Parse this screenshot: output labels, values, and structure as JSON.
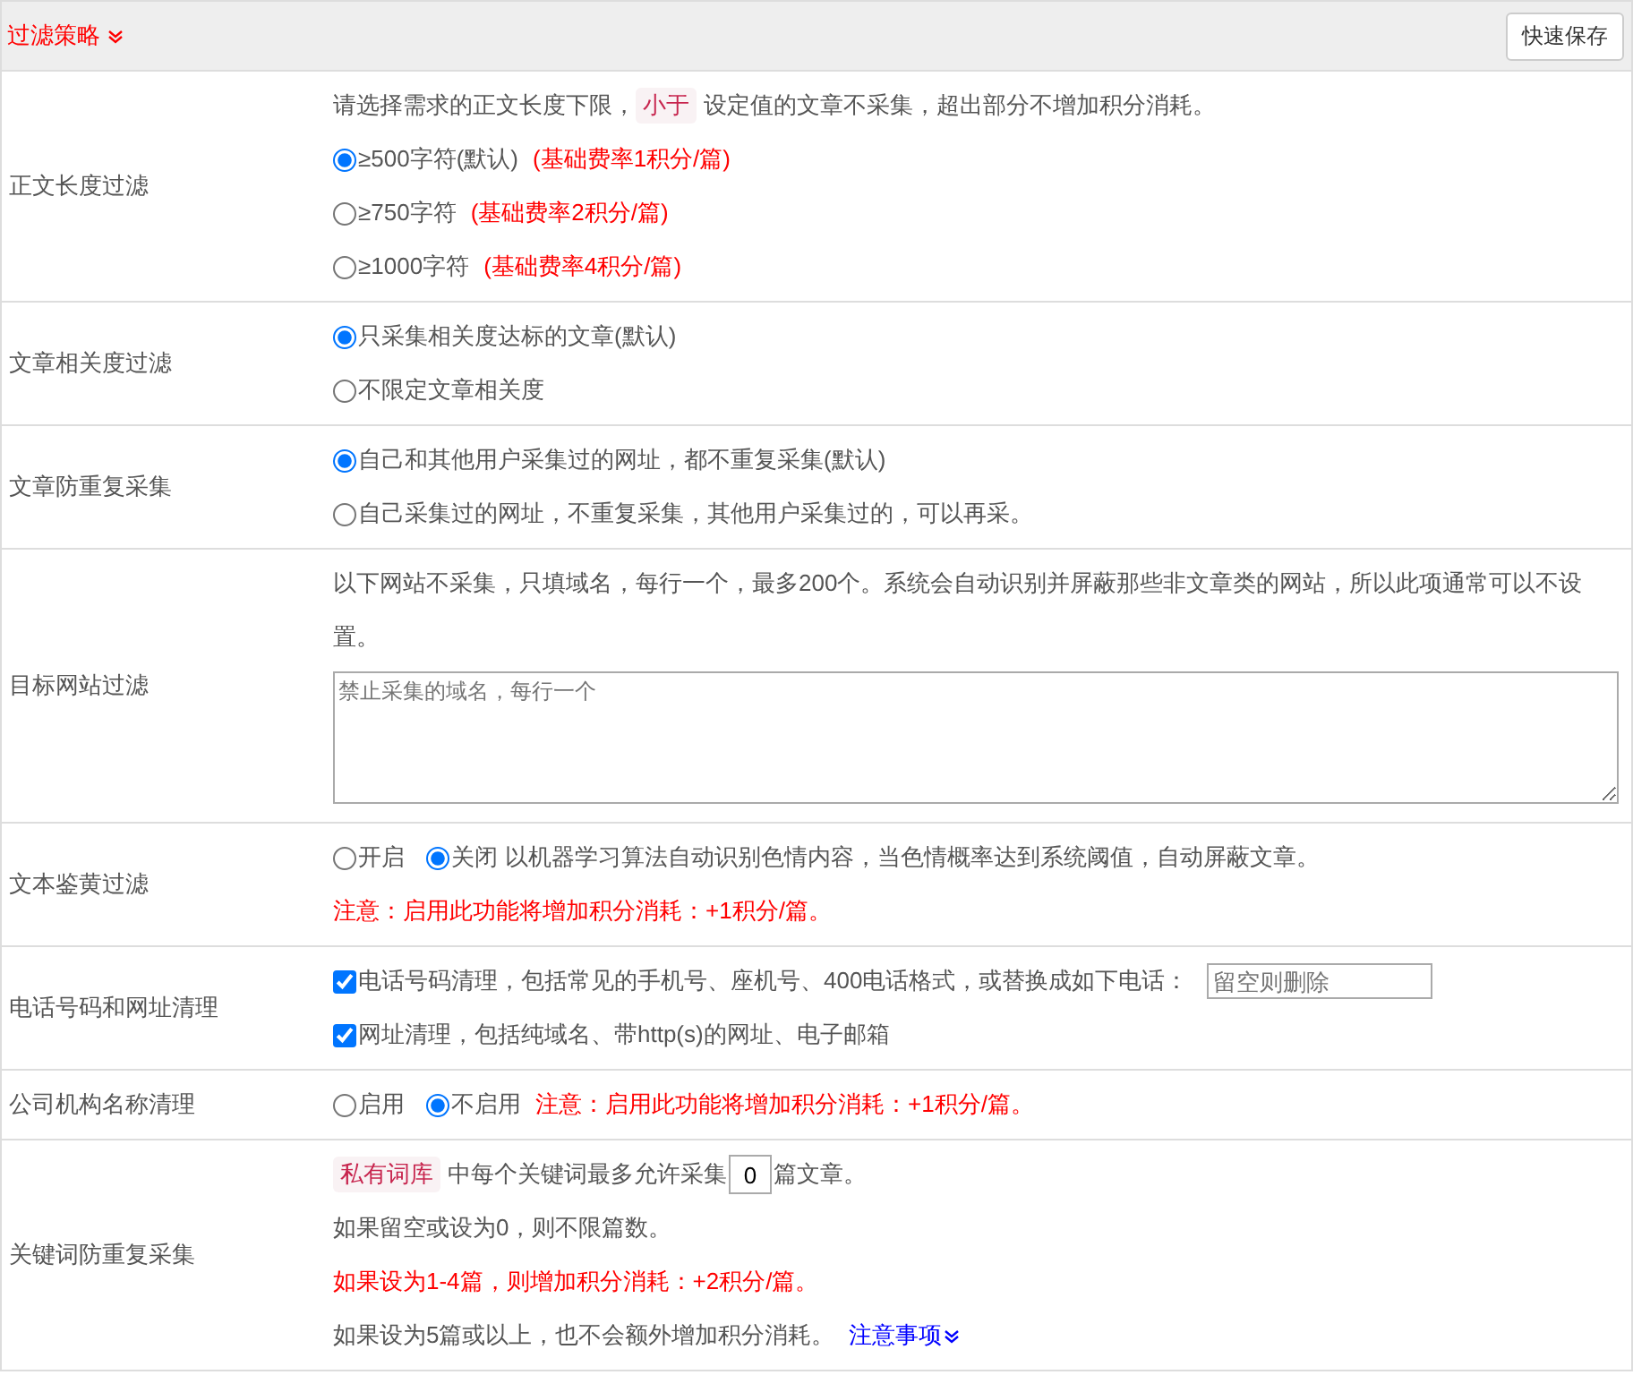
{
  "header": {
    "title": "过滤策略",
    "save_button": "快速保存"
  },
  "rows": [
    {
      "label": "正文长度过滤",
      "lines": [
        {
          "parts": [
            {
              "kind": "text",
              "text": "请选择需求的正文长度下限，"
            },
            {
              "kind": "chip",
              "text": "小于"
            },
            {
              "kind": "text",
              "text": "设定值的文章不采集，超出部分不增加积分消耗。"
            }
          ]
        },
        {
          "parts": [
            {
              "kind": "radio",
              "text": "≥500字符(默认)",
              "selected": true
            },
            {
              "kind": "red",
              "text": "(基础费率1积分/篇)"
            }
          ]
        },
        {
          "parts": [
            {
              "kind": "radio",
              "text": "≥750字符",
              "selected": false
            },
            {
              "kind": "red",
              "text": "(基础费率2积分/篇)"
            }
          ]
        },
        {
          "parts": [
            {
              "kind": "radio",
              "text": "≥1000字符",
              "selected": false
            },
            {
              "kind": "red",
              "text": "(基础费率4积分/篇)"
            }
          ]
        }
      ]
    },
    {
      "label": "文章相关度过滤",
      "lines": [
        {
          "parts": [
            {
              "kind": "radio",
              "text": "只采集相关度达标的文章(默认)",
              "selected": true
            }
          ]
        },
        {
          "parts": [
            {
              "kind": "radio",
              "text": "不限定文章相关度",
              "selected": false
            }
          ]
        }
      ]
    },
    {
      "label": "文章防重复采集",
      "lines": [
        {
          "parts": [
            {
              "kind": "radio",
              "text": "自己和其他用户采集过的网址，都不重复采集(默认)",
              "selected": true
            }
          ]
        },
        {
          "parts": [
            {
              "kind": "radio",
              "text": "自己采集过的网址，不重复采集，其他用户采集过的，可以再采。",
              "selected": false
            }
          ]
        }
      ]
    },
    {
      "label": "目标网站过滤",
      "lines": [
        {
          "parts": [
            {
              "kind": "text",
              "text": "以下网站不采集，只填域名，每行一个，最多200个。系统会自动识别并屏蔽那些非文章类的网站，所以此项通常可以不设置。"
            }
          ]
        },
        {
          "parts": [
            {
              "kind": "textarea",
              "placeholder": "禁止采集的域名，每行一个"
            }
          ]
        }
      ]
    },
    {
      "label": "文本鉴黄过滤",
      "lines": [
        {
          "parts": [
            {
              "kind": "radio",
              "text": "开启",
              "selected": false
            },
            {
              "kind": "radio",
              "text": "关闭",
              "selected": true
            },
            {
              "kind": "text",
              "text": "以机器学习算法自动识别色情内容，当色情概率达到系统阈值，自动屏蔽文章。"
            }
          ]
        },
        {
          "parts": [
            {
              "kind": "red",
              "text": "注意：启用此功能将增加积分消耗：+1积分/篇。"
            }
          ]
        }
      ]
    },
    {
      "label": "电话号码和网址清理",
      "lines": [
        {
          "parts": [
            {
              "kind": "checkbox",
              "text": "电话号码清理，包括常见的手机号、座机号、400电话格式，或替换成如下电话：",
              "checked": true
            },
            {
              "kind": "input",
              "placeholder": "留空则删除"
            }
          ]
        },
        {
          "parts": [
            {
              "kind": "checkbox",
              "text": "网址清理，包括纯域名、带http(s)的网址、电子邮箱",
              "checked": true
            }
          ]
        }
      ]
    },
    {
      "label": "公司机构名称清理",
      "lines": [
        {
          "parts": [
            {
              "kind": "radio",
              "text": "启用",
              "selected": false
            },
            {
              "kind": "radio",
              "text": "不启用",
              "selected": true
            },
            {
              "kind": "red",
              "text": "注意：启用此功能将增加积分消耗：+1积分/篇。"
            }
          ]
        }
      ]
    },
    {
      "label": "关键词防重复采集",
      "lines": [
        {
          "parts": [
            {
              "kind": "chip",
              "text": "私有词库"
            },
            {
              "kind": "text",
              "text": "中每个关键词最多允许采集"
            },
            {
              "kind": "number",
              "value": "0"
            },
            {
              "kind": "text",
              "text": "篇文章。"
            }
          ]
        },
        {
          "parts": [
            {
              "kind": "text",
              "text": "如果留空或设为0，则不限篇数。"
            }
          ]
        },
        {
          "parts": [
            {
              "kind": "red",
              "text": "如果设为1-4篇，则增加积分消耗：+2积分/篇。"
            }
          ]
        },
        {
          "parts": [
            {
              "kind": "text",
              "text": "如果设为5篇或以上，也不会额外增加积分消耗。"
            },
            {
              "kind": "link",
              "text": "注意事项"
            }
          ]
        }
      ]
    }
  ]
}
